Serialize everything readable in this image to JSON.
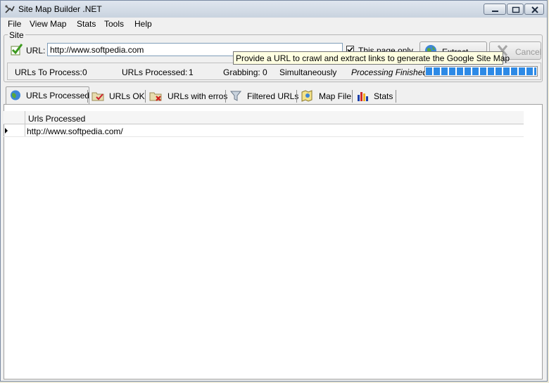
{
  "window": {
    "title": "Site Map Builder .NET"
  },
  "menu": [
    "File",
    "View Map",
    "Stats",
    "Tools",
    "Help"
  ],
  "site": {
    "group_label": "Site",
    "url_label": "URL:",
    "url_value": "http://www.softpedia.com",
    "checkbox_label": "This page only",
    "checkbox_checked": true,
    "extract_label": "Extract Links",
    "cancel_label": "Cancel"
  },
  "status": {
    "to_process_label": "URLs To Process:",
    "to_process_value": "0",
    "processed_label": "URLs Processed:",
    "processed_value": "1",
    "grabbing_label": "Grabbing:",
    "grabbing_value": "0",
    "simultaneously_label": "Simultaneously",
    "state_text": "Processing Finished",
    "progress": 1.0
  },
  "tooltip": "Provide a URL to crawl and extract links to generate the Google Site Map",
  "tabs": [
    {
      "label": "URLs Processed",
      "icon": "globe-icon"
    },
    {
      "label": "URLs OK",
      "icon": "folder-check-icon"
    },
    {
      "label": "URLs with erros",
      "icon": "folder-error-icon"
    },
    {
      "label": "Filtered URLs",
      "icon": "filter-icon"
    },
    {
      "label": "Map File",
      "icon": "map-file-icon"
    },
    {
      "label": "Stats",
      "icon": "bar-chart-icon"
    }
  ],
  "grid": {
    "header": "Urls Processed",
    "rows": [
      "http://www.softpedia.com/"
    ]
  },
  "colors": {
    "progress": "#2d8ae6",
    "tooltip_bg": "#ffffe1"
  }
}
